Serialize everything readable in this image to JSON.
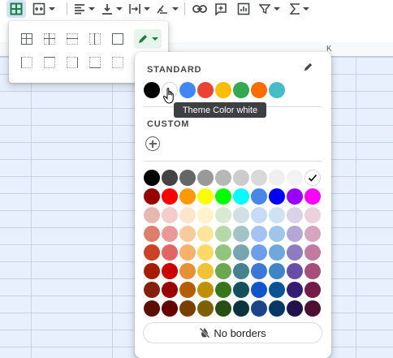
{
  "toolbar": {
    "items": [
      {
        "name": "borders-button",
        "icon": "border-all-icon"
      },
      {
        "name": "merge-cells-button",
        "icon": "merge-icon"
      },
      {
        "name": "horizontal-align-button",
        "icon": "align-left-icon"
      },
      {
        "name": "vertical-align-button",
        "icon": "align-bottom-icon"
      },
      {
        "name": "text-wrapping-button",
        "icon": "wrap-icon"
      },
      {
        "name": "text-rotation-button",
        "icon": "rotation-icon"
      },
      {
        "name": "insert-link-button",
        "icon": "link-icon"
      },
      {
        "name": "insert-comment-button",
        "icon": "comment-add-icon"
      },
      {
        "name": "insert-chart-button",
        "icon": "chart-icon"
      },
      {
        "name": "create-filter-button",
        "icon": "filter-icon"
      },
      {
        "name": "functions-button",
        "icon": "sigma-icon"
      }
    ]
  },
  "sheet": {
    "col_header_letter": "K"
  },
  "color_popup": {
    "standard_label": "STANDARD",
    "custom_label": "CUSTOM",
    "tooltip": "Theme Color white",
    "no_borders_label": "No borders",
    "standard_colors": [
      "#000000",
      "#ffffff",
      "#4285f4",
      "#ea4335",
      "#fbbc04",
      "#34a853",
      "#ff6d01",
      "#46bdc6"
    ],
    "palette_rows": [
      [
        "#000000",
        "#434343",
        "#666666",
        "#999999",
        "#b7b7b7",
        "#cccccc",
        "#d9d9d9",
        "#efefef",
        "#f3f3f3",
        "#ffffff"
      ],
      [
        "#980000",
        "#ff0000",
        "#ff9900",
        "#ffff00",
        "#00ff00",
        "#00ffff",
        "#4a86e8",
        "#0000ff",
        "#9900ff",
        "#ff00ff"
      ],
      [
        "#e6b8af",
        "#f4cccc",
        "#fce5cd",
        "#fff2cc",
        "#d9ead3",
        "#d0e0e3",
        "#c9daf8",
        "#cfe2f3",
        "#d9d2e9",
        "#ead1dc"
      ],
      [
        "#dd7e6b",
        "#ea9999",
        "#f9cb9c",
        "#ffe599",
        "#b6d7a8",
        "#a2c4c9",
        "#a4c2f4",
        "#9fc5e8",
        "#b4a7d6",
        "#d5a6bd"
      ],
      [
        "#cc4125",
        "#e06666",
        "#f6b26b",
        "#ffd966",
        "#93c47d",
        "#76a5af",
        "#6d9eeb",
        "#6fa8dc",
        "#8e7cc3",
        "#c27ba0"
      ],
      [
        "#a61c00",
        "#cc0000",
        "#e69138",
        "#f1c232",
        "#6aa84f",
        "#45818e",
        "#3c78d8",
        "#3d85c6",
        "#674ea7",
        "#a64d79"
      ],
      [
        "#85200c",
        "#990000",
        "#b45f06",
        "#bf9000",
        "#38761d",
        "#134f5c",
        "#1155cc",
        "#0b5394",
        "#351c75",
        "#741b47"
      ],
      [
        "#5b0f00",
        "#660000",
        "#783f04",
        "#7f6000",
        "#274e13",
        "#0c343d",
        "#1c4587",
        "#073763",
        "#20124d",
        "#4c1130"
      ]
    ],
    "selected_color": "#ffffff"
  }
}
